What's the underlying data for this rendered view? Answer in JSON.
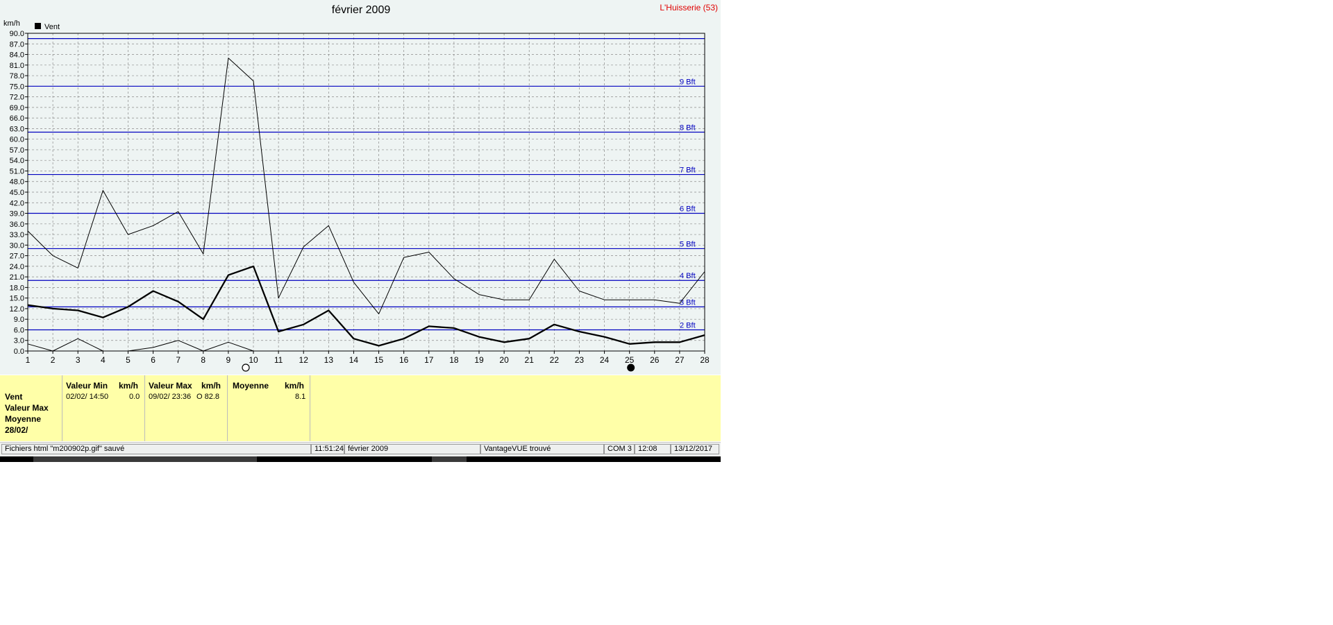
{
  "chart_data": {
    "type": "line",
    "title": "février 2009",
    "location": "L'Huisserie (53)",
    "ylabel": "km/h",
    "legend": [
      "Vent"
    ],
    "legend_position": "top-left",
    "ylim": [
      0,
      90
    ],
    "ytick_step": 3,
    "x": [
      1,
      2,
      3,
      4,
      5,
      6,
      7,
      8,
      9,
      10,
      11,
      12,
      13,
      14,
      15,
      16,
      17,
      18,
      19,
      20,
      21,
      22,
      23,
      24,
      25,
      26,
      27,
      28
    ],
    "series": [
      {
        "role": "max",
        "values": [
          34,
          27,
          23.5,
          45.5,
          33,
          35.5,
          39.5,
          27.5,
          83,
          76.5,
          15,
          29.5,
          35.5,
          19.5,
          10.5,
          26.5,
          28,
          20.5,
          16,
          14.5,
          14.5,
          26,
          17,
          14.5,
          14.5,
          14.5,
          13.5,
          22.5
        ]
      },
      {
        "role": "mean",
        "values": [
          13,
          12,
          11.5,
          9.5,
          12.5,
          17,
          14,
          9,
          21.5,
          24,
          5.5,
          7.5,
          11.5,
          3.5,
          1.5,
          3.5,
          7,
          6.5,
          4,
          2.5,
          3.5,
          7.5,
          5.5,
          4,
          2,
          2.5,
          2.5,
          4.5
        ]
      },
      {
        "role": "min",
        "values": [
          2,
          0,
          3.5,
          0,
          0,
          1,
          3,
          0,
          2.5,
          0,
          null,
          null,
          null,
          null,
          null,
          null,
          null,
          null,
          null,
          null,
          null,
          null,
          null,
          null,
          null,
          null,
          null,
          null
        ]
      }
    ],
    "beaufort": [
      {
        "value": 6,
        "label": "2 Bft"
      },
      {
        "value": 12.5,
        "label": "3 Bft"
      },
      {
        "value": 20,
        "label": "4 Bft"
      },
      {
        "value": 29,
        "label": "5 Bft"
      },
      {
        "value": 39,
        "label": "6 Bft"
      },
      {
        "value": 50,
        "label": "7 Bft"
      },
      {
        "value": 62,
        "label": "8 Bft"
      },
      {
        "value": 75,
        "label": "9 Bft"
      },
      {
        "value": 88.5,
        "label": ""
      }
    ],
    "moon_markers": [
      {
        "day": 10,
        "phase": "full"
      },
      {
        "day": 25,
        "phase": "new"
      }
    ],
    "grid": true
  },
  "info": {
    "labels": [
      "Vent",
      "Valeur Max",
      "Moyenne",
      "28/02/"
    ],
    "min_header": "Valeur Min",
    "min_unit": "km/h",
    "min_date": "02/02/  14:50",
    "min_value": "0.0",
    "max_header": "Valeur Max",
    "max_unit": "km/h",
    "max_date": "09/02/  23:36",
    "max_value": "O  82.8",
    "avg_header": "Moyenne",
    "avg_unit": "km/h",
    "avg_value": "8.1"
  },
  "status": {
    "message": "Fichiers html  \"m200902p.gif\"  sauvé",
    "time": "11:51:24",
    "period": "février 2009",
    "station": "VantageVUE trouvé",
    "port": "COM 3",
    "clock": "12:08",
    "date": "13/12/2017"
  },
  "colors": {
    "beaufort": "#0000c0",
    "location": "#e00000",
    "panel": "#ffffa8",
    "background": "#eef4f3"
  }
}
